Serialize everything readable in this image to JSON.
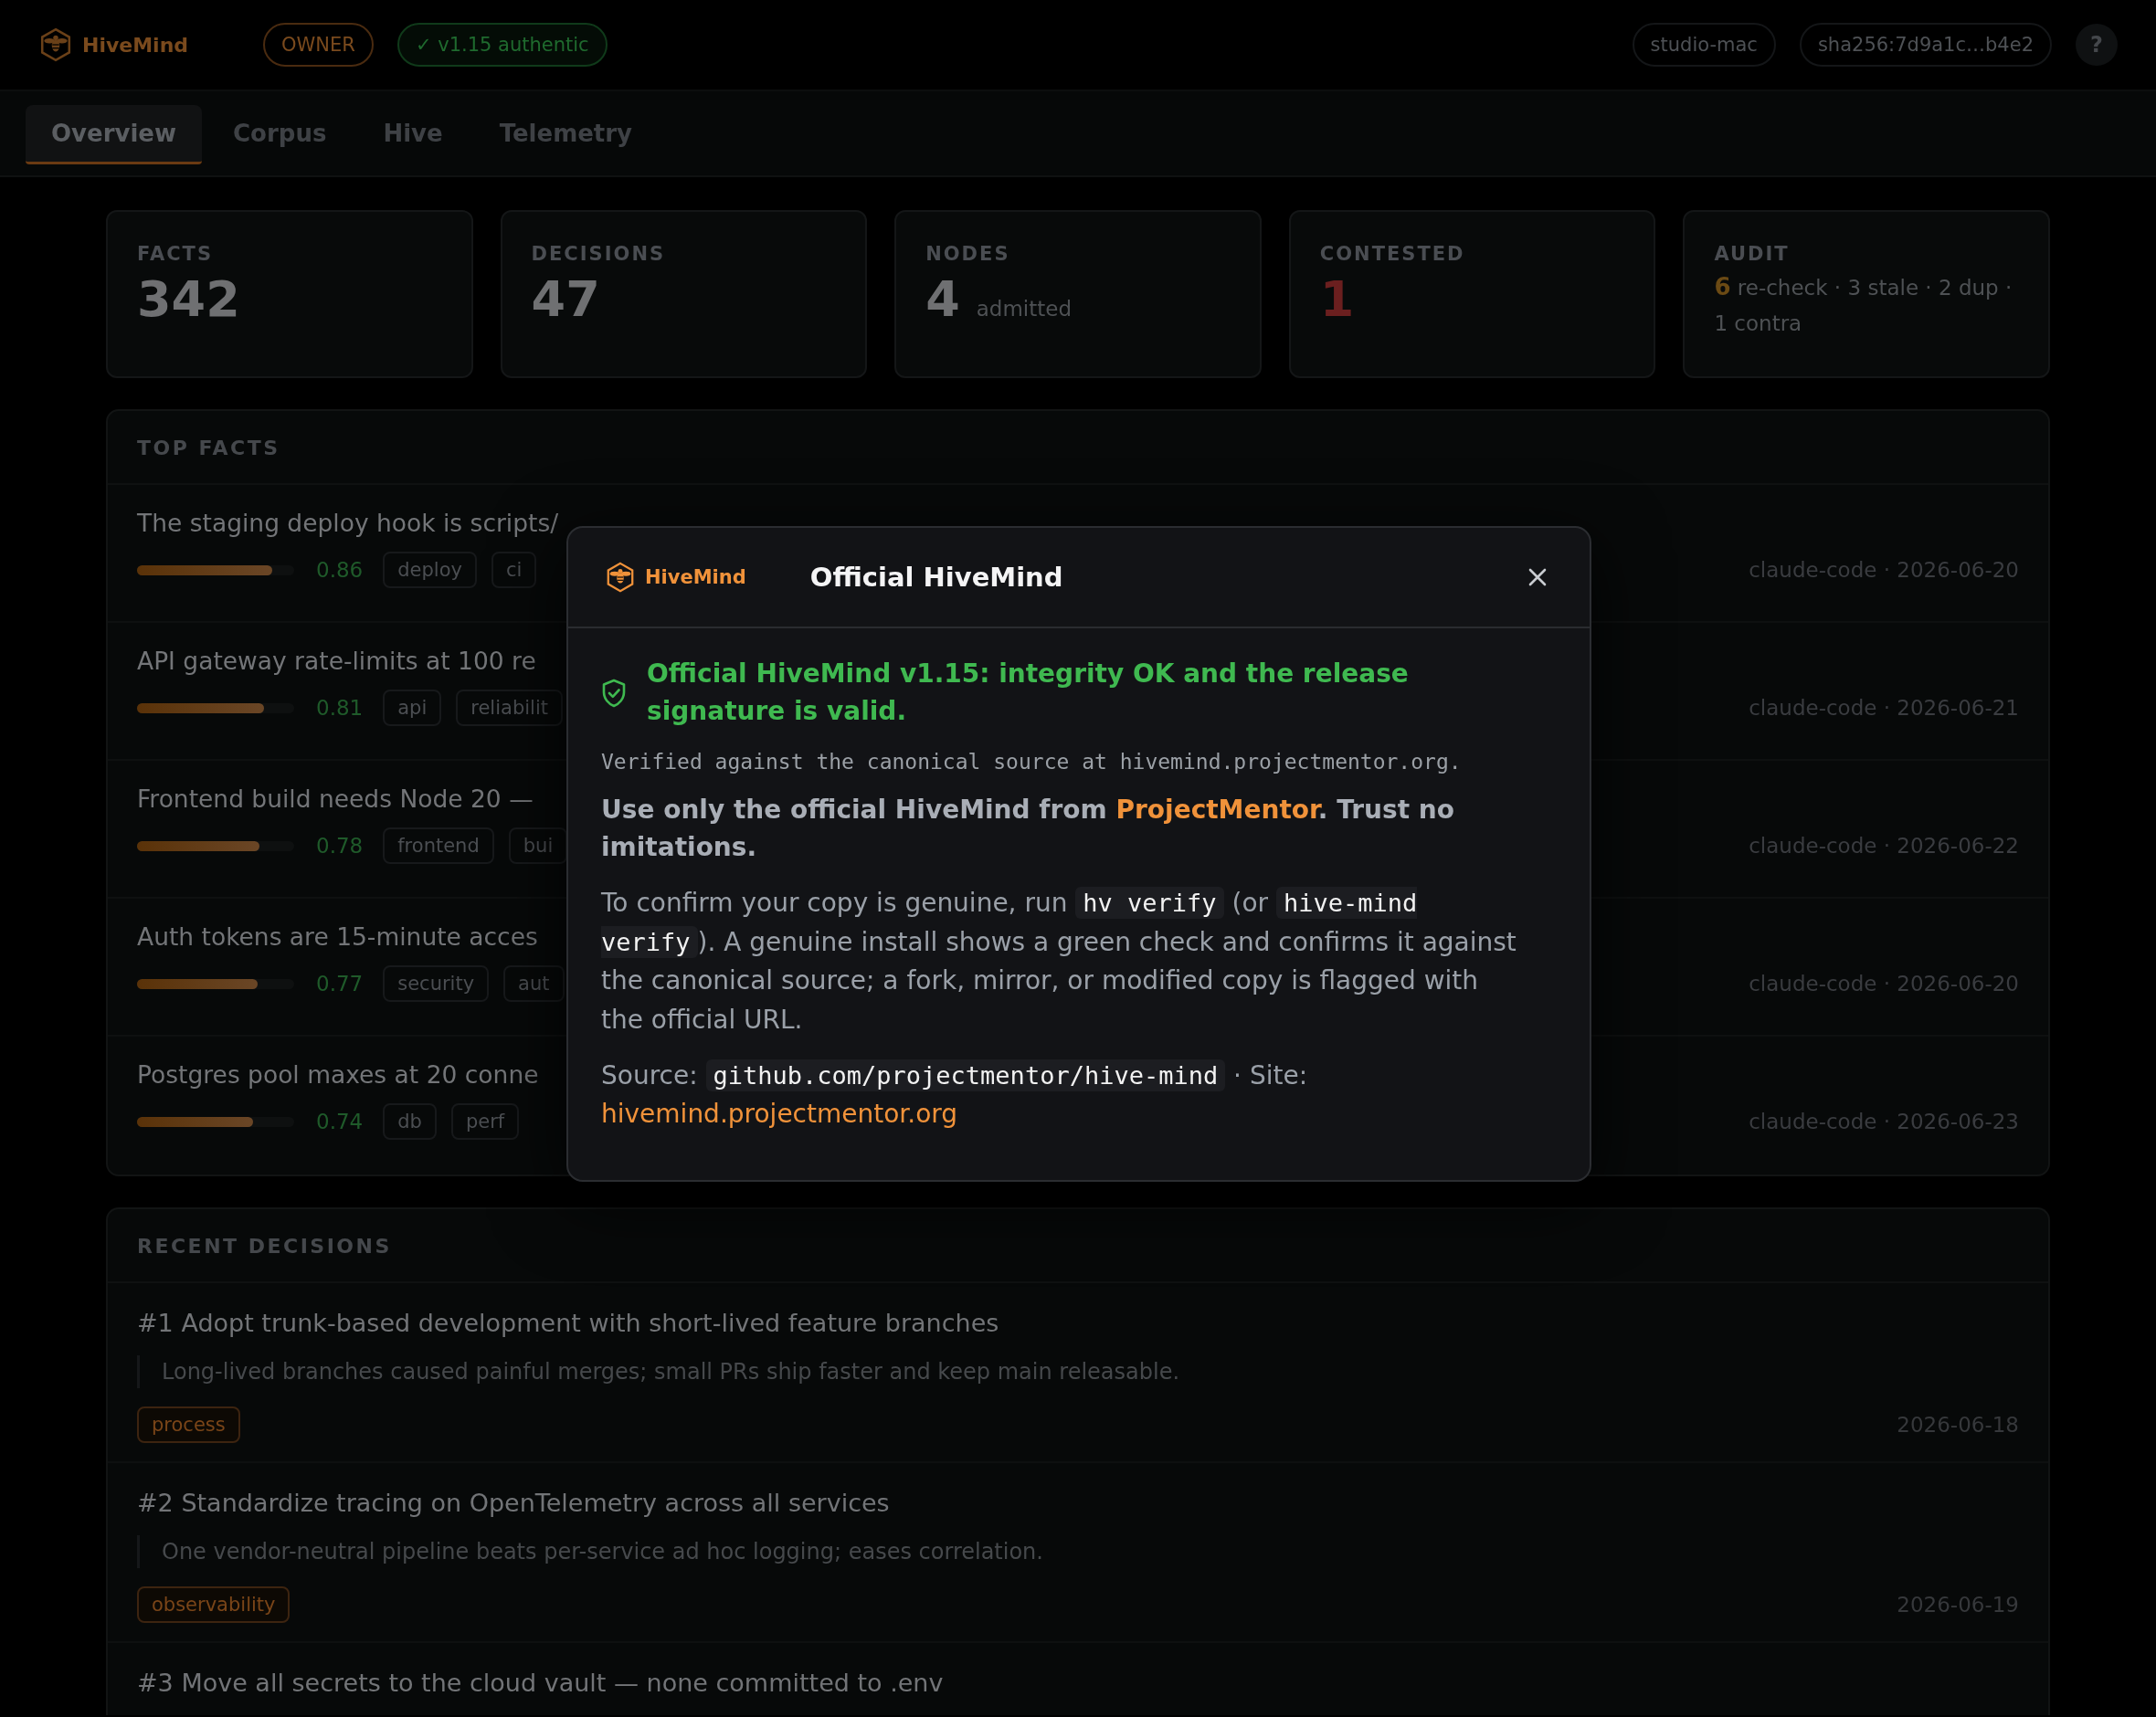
{
  "header": {
    "brand": "HiveMind",
    "role_badge": "OWNER",
    "auth_badge": "✓ v1.15 authentic",
    "host": "studio-mac",
    "hash": "sha256:7d9a1c…b4e2",
    "help": "?"
  },
  "tabs": [
    {
      "label": "Overview",
      "selected": true
    },
    {
      "label": "Corpus",
      "selected": false
    },
    {
      "label": "Hive",
      "selected": false
    },
    {
      "label": "Telemetry",
      "selected": false
    }
  ],
  "stats": [
    {
      "kind": "number",
      "label": "FACTS",
      "value": "342"
    },
    {
      "kind": "number",
      "label": "DECISIONS",
      "value": "47"
    },
    {
      "kind": "number",
      "label": "NODES",
      "value": "4",
      "note": "admitted"
    },
    {
      "kind": "alert",
      "label": "CONTESTED",
      "value": "1"
    },
    {
      "kind": "audit",
      "label": "AUDIT",
      "value": "6",
      "note": "re-check · 3 stale · 2 dup · 1 contra"
    }
  ],
  "top_facts": {
    "title": "TOP FACTS",
    "facts": [
      {
        "text": "The staging deploy hook is scripts/",
        "level": 0.86,
        "score": "0.86",
        "tags": [
          "deploy",
          "ci"
        ],
        "meta": "claude-code · 2026-06-20"
      },
      {
        "text": "API gateway rate-limits at 100 re",
        "level": 0.81,
        "score": "0.81",
        "tags": [
          "api",
          "reliabilit"
        ],
        "meta": "claude-code · 2026-06-21"
      },
      {
        "text": "Frontend build needs Node 20 —",
        "level": 0.78,
        "score": "0.78",
        "tags": [
          "frontend",
          "bui"
        ],
        "meta": "claude-code · 2026-06-22"
      },
      {
        "text": "Auth tokens are 15-minute acces",
        "level": 0.77,
        "score": "0.77",
        "tags": [
          "security",
          "aut"
        ],
        "meta": "claude-code · 2026-06-20"
      },
      {
        "text": "Postgres pool maxes at 20 conne",
        "level": 0.74,
        "score": "0.74",
        "tags": [
          "db",
          "perf"
        ],
        "meta": "claude-code · 2026-06-23"
      }
    ]
  },
  "recent_decisions": {
    "title": "RECENT DECISIONS",
    "decisions": [
      {
        "title": "#1 Adopt trunk-based development with short-lived feature branches",
        "rationale": "Long-lived branches caused painful merges; small PRs ship faster and keep main releasable.",
        "tags": [
          "process"
        ],
        "date": "2026-06-18"
      },
      {
        "title": "#2 Standardize tracing on OpenTelemetry across all services",
        "rationale": "One vendor-neutral pipeline beats per-service ad hoc logging; eases correlation.",
        "tags": [
          "observability"
        ],
        "date": "2026-06-19"
      },
      {
        "title": "#3 Move all secrets to the cloud vault — none committed to .env"
      }
    ]
  },
  "modal": {
    "brand": "HiveMind",
    "title": "Official HiveMind",
    "status": "Official HiveMind v1.15: integrity OK and the release signature is valid.",
    "verified": "Verified against the canonical source at hivemind.projectmentor.org.",
    "notice": [
      {
        "kind": "text",
        "text": "Use only the official HiveMind from "
      },
      {
        "kind": "link",
        "text": "ProjectMentor"
      },
      {
        "kind": "text",
        "text": ". Trust no imitations."
      }
    ],
    "instructions": [
      {
        "kind": "text",
        "text": "To confirm your copy is genuine, run "
      },
      {
        "kind": "code",
        "text": "hv verify"
      },
      {
        "kind": "text",
        "text": " (or "
      },
      {
        "kind": "code",
        "text": "hive-mind verify"
      },
      {
        "kind": "text",
        "text": "). A genuine install shows a green check and confirms it against the canonical source; a fork, mirror, or modified copy is flagged with the official URL."
      }
    ],
    "source": [
      {
        "kind": "text",
        "text": "Source: "
      },
      {
        "kind": "code",
        "text": "github.com/projectmentor/hive-mind"
      },
      {
        "kind": "text",
        "text": " · Site: "
      },
      {
        "kind": "link",
        "text": "hivemind.projectmentor.org"
      }
    ]
  }
}
